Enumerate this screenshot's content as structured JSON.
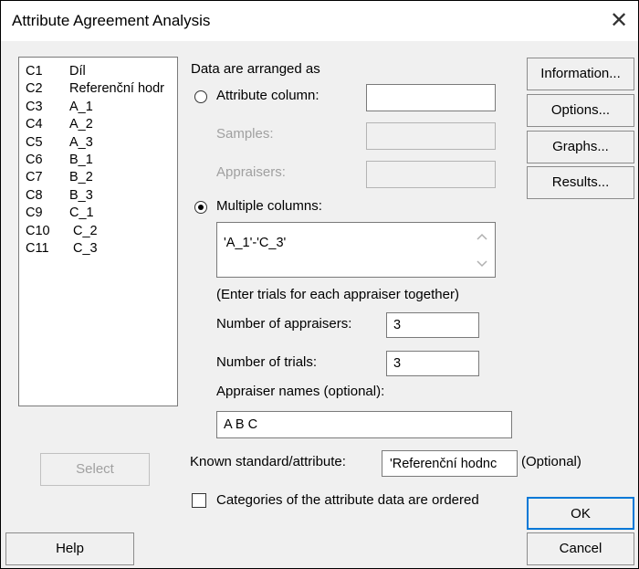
{
  "window": {
    "title": "Attribute Agreement Analysis",
    "close_glyph": "✕"
  },
  "columns": [
    {
      "id": "C1",
      "name": "Díl"
    },
    {
      "id": "C2",
      "name": "Referenční hodr"
    },
    {
      "id": "C3",
      "name": "A_1"
    },
    {
      "id": "C4",
      "name": "A_2"
    },
    {
      "id": "C5",
      "name": "A_3"
    },
    {
      "id": "C6",
      "name": "B_1"
    },
    {
      "id": "C7",
      "name": "B_2"
    },
    {
      "id": "C8",
      "name": "B_3"
    },
    {
      "id": "C9",
      "name": "C_1"
    },
    {
      "id": "C10",
      "name": "C_2"
    },
    {
      "id": "C11",
      "name": "C_3"
    }
  ],
  "select_label": "Select",
  "help_label": "Help",
  "arrangement": {
    "heading": "Data are arranged as",
    "attribute_column_label": "Attribute column:",
    "samples_label": "Samples:",
    "appraisers_label": "Appraisers:",
    "multiple_columns_label": "Multiple columns:",
    "selected": "multiple_columns",
    "multiple_columns_value": "'A_1'-'C_3'",
    "hint": "(Enter trials for each appraiser together)",
    "num_appraisers_label": "Number of appraisers:",
    "num_appraisers_value": "3",
    "num_trials_label": "Number of trials:",
    "num_trials_value": "3",
    "appraiser_names_label": "Appraiser names (optional):",
    "appraiser_names_value": "A B C"
  },
  "known_standard": {
    "label": "Known standard/attribute:",
    "value": "'Referenční hodnc",
    "optional": "(Optional)"
  },
  "ordered_checkbox": {
    "label": "Categories of the attribute data are ordered",
    "checked": false
  },
  "side_buttons": {
    "information": "Information...",
    "options": "Options...",
    "graphs": "Graphs...",
    "results": "Results..."
  },
  "ok_label": "OK",
  "cancel_label": "Cancel"
}
